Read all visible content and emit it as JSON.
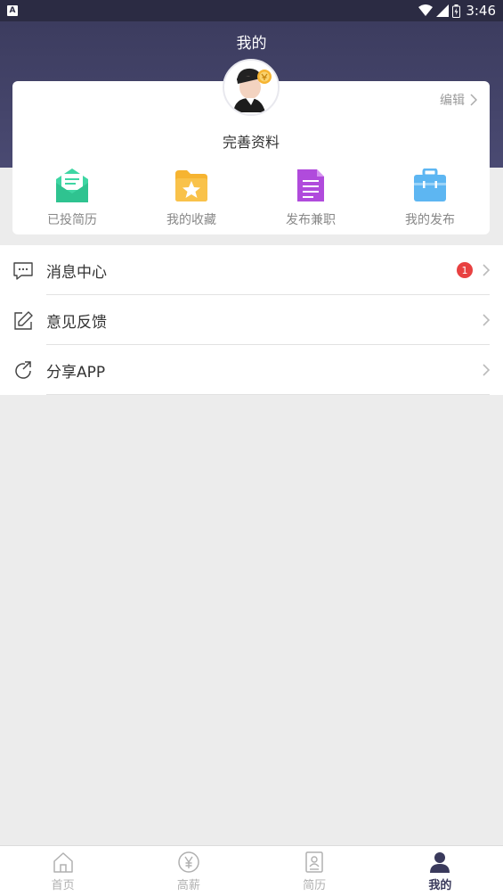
{
  "status_bar": {
    "time": "3:46",
    "left_icon": "A"
  },
  "header": {
    "title": "我的"
  },
  "profile": {
    "edit_label": "编辑",
    "complete_label": "完善资料"
  },
  "quick_actions": [
    {
      "label": "已投简历",
      "icon": "envelope-icon",
      "color": "#3ed6a3"
    },
    {
      "label": "我的收藏",
      "icon": "star-folder-icon",
      "color": "#f6b431"
    },
    {
      "label": "发布兼职",
      "icon": "document-icon",
      "color": "#b04bdc"
    },
    {
      "label": "我的发布",
      "icon": "briefcase-icon",
      "color": "#5db6f2"
    }
  ],
  "menu": [
    {
      "label": "消息中心",
      "icon": "message-icon",
      "badge": "1"
    },
    {
      "label": "意见反馈",
      "icon": "edit-icon"
    },
    {
      "label": "分享APP",
      "icon": "share-icon"
    }
  ],
  "tabbar": [
    {
      "label": "首页",
      "icon": "home-icon",
      "active": false
    },
    {
      "label": "高薪",
      "icon": "yen-icon",
      "active": false
    },
    {
      "label": "简历",
      "icon": "resume-icon",
      "active": false
    },
    {
      "label": "我的",
      "icon": "user-icon",
      "active": true
    }
  ],
  "colors": {
    "header": "#3a3a5c",
    "badge": "#e84141"
  }
}
